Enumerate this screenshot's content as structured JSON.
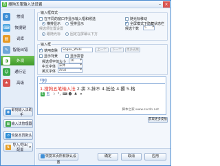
{
  "window": {
    "title": "搜狗五笔输入法设置"
  },
  "sidebar": {
    "items": [
      {
        "label": "常规",
        "icon": "general-icon",
        "color": "#3f8fd6"
      },
      {
        "label": "快捷键",
        "icon": "keyboard-icon",
        "color": "#4aa3e0"
      },
      {
        "label": "词库",
        "icon": "lexicon-icon",
        "color": "#e69a24"
      },
      {
        "label": "智能纠错",
        "icon": "correction-icon",
        "color": "#6fa7d8"
      },
      {
        "label": "外观",
        "icon": "appearance-icon",
        "color": "#ffffff"
      },
      {
        "label": "通行证",
        "icon": "passport-icon",
        "color": "#39a94a"
      },
      {
        "label": "高级",
        "icon": "advanced-icon",
        "color": "#d9534f"
      }
    ],
    "active_index": 4,
    "buttons": [
      {
        "label": "即刻输入法助手",
        "icon": "assistant-icon",
        "color": "#3f8fd6"
      },
      {
        "label": "输入法管理器",
        "icon": "manager-icon",
        "color": "#3fa84a"
      },
      {
        "label": "恢复本页默认",
        "icon": "restore-icon",
        "color": "#2f8fd6"
      },
      {
        "label": "导入/导出配置",
        "icon": "import-export-icon",
        "color": "#e6a02a"
      }
    ]
  },
  "mode_group": {
    "title": "输入框样式",
    "opt_hide_window": "在不同的窗口中显示输入框和候选",
    "opt_follow_cursor": "随光标移动",
    "radio_horizontal": "横排显示",
    "radio_vertical": "竖排显示",
    "opt_full_screen": "全屏模式下隐藏状态栏",
    "cand_count_label": "候选个数",
    "cand_count_value": "5",
    "position_label": "候选项位置设置",
    "radio_follow": "跟随光标",
    "radio_fixed": "固定在屏幕以下方"
  },
  "skin_group": {
    "title": "输入框",
    "use_skin_label": "使用皮肤",
    "skin_name": "Sogou_Wubi",
    "btn_prev": "上一个",
    "btn_next": "下一个",
    "btn_more": "更多皮肤",
    "show_background": "显示背景",
    "show_pinyin": "显示拼音",
    "font_size_label": "候选项字体大小",
    "font_size_value": "16",
    "cn_font_label": "中文字体",
    "cn_font_value": "宋体",
    "en_font_label": "英文字体",
    "en_font_value": "Arial"
  },
  "preview": {
    "pinyin": "rgg",
    "candidates": [
      {
        "text": "1.搜狗五笔输入法",
        "highlight": true
      },
      {
        "text": "2.拼",
        "highlight": false
      },
      {
        "text": "3.抹不",
        "highlight": false
      },
      {
        "text": "4.抵径",
        "highlight": false
      },
      {
        "text": "4.撂",
        "highlight": false
      },
      {
        "text": "5.格",
        "highlight": false
      }
    ],
    "watermark": "脚本之家 www.sxcdn.net",
    "reset_label": "获取更多皮肤"
  },
  "bottom": {
    "restore_all": "恢复本页所有默认设置",
    "ok": "确定",
    "cancel": "取消",
    "apply": "应用"
  }
}
